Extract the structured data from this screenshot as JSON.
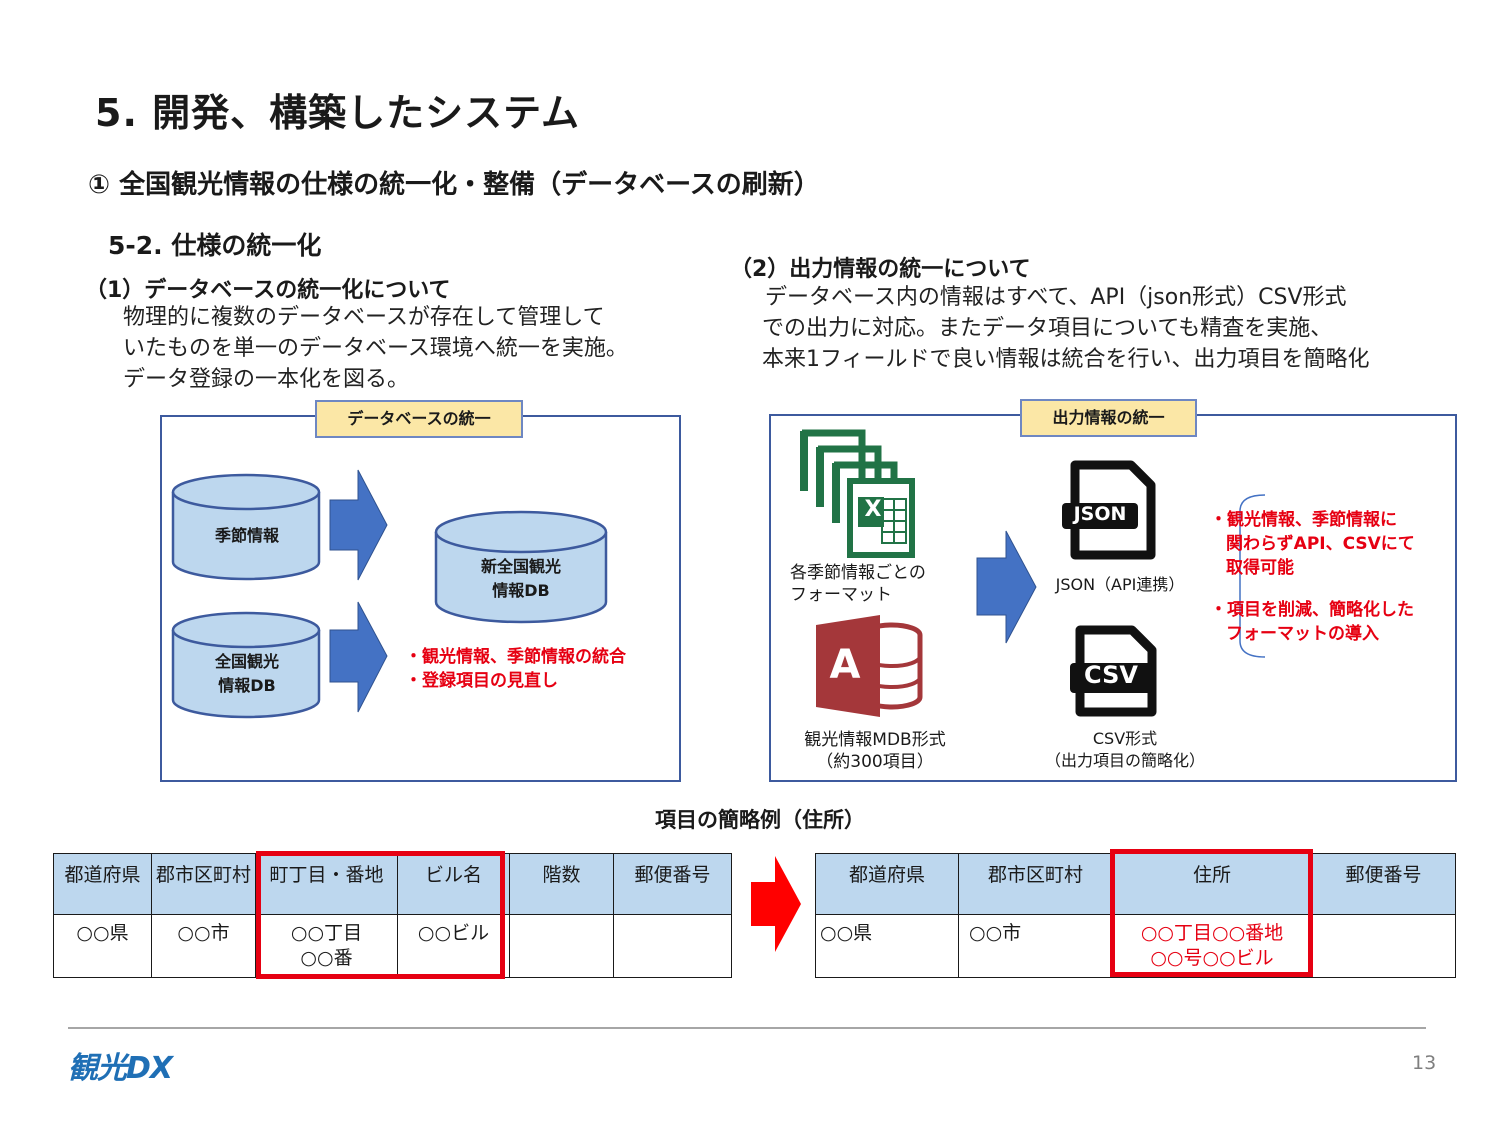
{
  "header": {
    "title": "5. 開発、構築したシステム",
    "subtitle": "① 全国観光情報の仕様の統一化・整備（データベースの刷新）",
    "section": "5-2. 仕様の統一化"
  },
  "left": {
    "heading": "（1）データベースの統一化について",
    "lines": [
      "物理的に複数のデータベースが存在して管理して",
      "いたものを単一のデータベース環境へ統一を実施。",
      "データ登録の一本化を図る。"
    ],
    "panel": {
      "tag": "データベースの統一",
      "db_seasonal": "季節情報",
      "db_national": [
        "全国観光",
        "情報DB"
      ],
      "db_new": [
        "新全国観光",
        "情報DB"
      ],
      "notes": [
        "・観光情報、季節情報の統合",
        "・登録項目の見直し"
      ]
    }
  },
  "right": {
    "heading": "（2）出力情報の統一について",
    "lines": [
      "データベース内の情報はすべて、API（json形式）CSV形式",
      "での出力に対応。またデータ項目についても精査を実施、",
      "本来1フィールドで良い情報は統合を行い、出力項目を簡略化"
    ],
    "panel": {
      "tag": "出力情報の統一",
      "excel_caption": [
        "各季節情報ごとの",
        "フォーマット"
      ],
      "access_caption": [
        "観光情報MDB形式",
        "（約300項目）"
      ],
      "json_caption": "JSON（API連携）",
      "csv_caption": [
        "CSV形式",
        "（出力項目の簡略化）"
      ],
      "json_label": "JSON",
      "csv_label": "CSV",
      "excel_letter": "X",
      "access_letter": "A",
      "notes": [
        "・観光情報、季節情報に",
        "関わらずAPI、CSVにて",
        "取得可能",
        "・項目を削減、簡略化した",
        "フォーマットの導入"
      ]
    }
  },
  "example": {
    "title": "項目の簡略例（住所）",
    "before": {
      "headers": [
        "都道府県",
        "郡市区町村",
        "町丁目・番地",
        "ビル名",
        "階数",
        "郵便番号"
      ],
      "row": [
        "○○県",
        "○○市",
        "○○丁目\n○○番",
        "○○ビル",
        "",
        ""
      ]
    },
    "after": {
      "headers": [
        "都道府県",
        "郡市区町村",
        "住所",
        "郵便番号"
      ],
      "row": [
        "○○県",
        "○○市",
        "○○丁目○○番地\n○○号○○ビル",
        ""
      ]
    }
  },
  "footer": {
    "logo": "観光DX",
    "page": "13"
  },
  "colors": {
    "accent_red": "#e60012",
    "panel_border": "#3d5a9e",
    "db_fill": "#bdd7ee",
    "arrow_blue": "#4472c4",
    "tag_fill": "#fbe7a6",
    "excel_green": "#217346",
    "access_red": "#a4373a"
  }
}
